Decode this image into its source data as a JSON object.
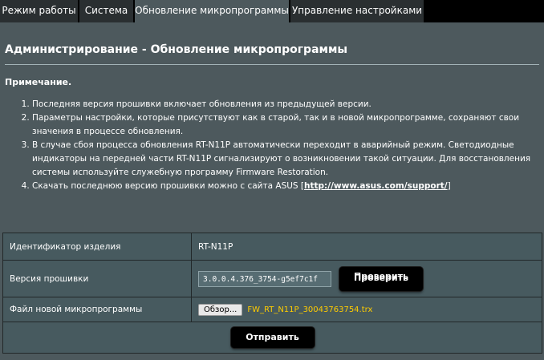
{
  "tabs": [
    {
      "label": "Режим работы",
      "active": false
    },
    {
      "label": "Система",
      "active": false
    },
    {
      "label": "Обновление микропрограммы",
      "active": true
    },
    {
      "label": "Управление настройками",
      "active": false
    }
  ],
  "page": {
    "title": "Администрирование - Обновление микропрограммы",
    "note_heading": "Примечание.",
    "notes": [
      "Последняя версия прошивки включает обновления из предыдущей версии.",
      "Параметры настройки, которые присутствуют как в старой, так и в новой микропрограмме, сохраняют свои значения в процессе обновления.",
      "В случае сбоя процесса обновления RT-N11P автоматически переходит в аварийный режим. Светодиодные индикаторы на передней части RT-N11P сигнализируют о возникновении такой ситуации. Для восстановления системы используйте служебную программу Firmware Restoration."
    ],
    "note4_prefix": "Скачать последнюю версию прошивки можно с сайта ASUS [",
    "note4_link": "http://www.asus.com/support/",
    "note4_suffix": "]"
  },
  "table": {
    "product_id_label": "Идентификатор изделия",
    "product_id_value": "RT-N11P",
    "firmware_version_label": "Версия прошивки",
    "firmware_version_value": "3.0.0.4.376_3754-g5ef7c1f",
    "check_button_label": "Проверить",
    "new_firmware_label": "Файл новой микропрограммы",
    "browse_button_label": "Обзор...",
    "selected_file": "FW_RT_N11P_30043763754.trx",
    "submit_button_label": "Отправить"
  },
  "colors": {
    "background": "#4d595d",
    "tab_bar": "#000000",
    "file_name": "#ffcc00"
  }
}
